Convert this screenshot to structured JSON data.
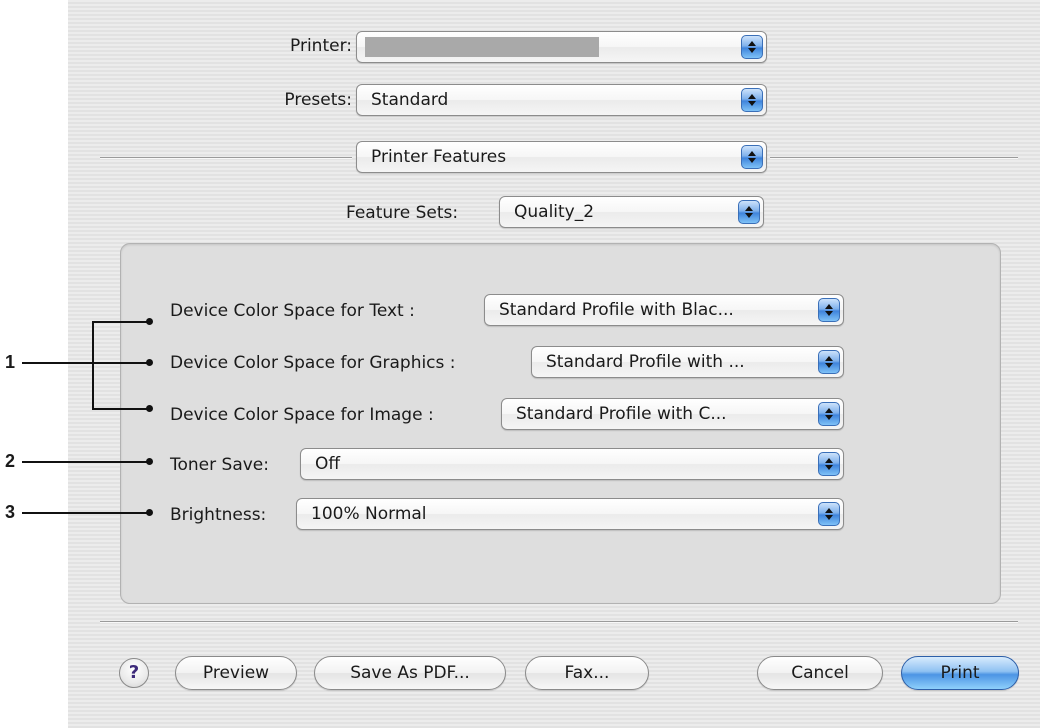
{
  "printer": {
    "label": "Printer:",
    "value": ""
  },
  "presets": {
    "label": "Presets:",
    "value": "Standard"
  },
  "panel": {
    "value": "Printer Features"
  },
  "feature_sets": {
    "label": "Feature Sets:",
    "value": "Quality_2"
  },
  "settings": {
    "text_space": {
      "label": "Device Color Space for Text :",
      "value": "Standard Profile with Blac..."
    },
    "graphics_space": {
      "label": "Device Color Space for Graphics :",
      "value": "Standard Profile with ..."
    },
    "image_space": {
      "label": "Device Color Space for Image :",
      "value": "Standard Profile with C..."
    },
    "toner_save": {
      "label": "Toner Save:",
      "value": "Off"
    },
    "brightness": {
      "label": "Brightness:",
      "value": "100% Normal"
    }
  },
  "callouts": {
    "one": "1",
    "two": "2",
    "three": "3"
  },
  "buttons": {
    "help": "?",
    "preview": "Preview",
    "save_pdf": "Save As PDF...",
    "fax": "Fax...",
    "cancel": "Cancel",
    "print": "Print"
  },
  "icons": {
    "popup_arrows": "up-down-arrows-icon",
    "help": "question-mark-icon"
  },
  "colors": {
    "accent": "#4c94e4",
    "callout": "#111111"
  }
}
